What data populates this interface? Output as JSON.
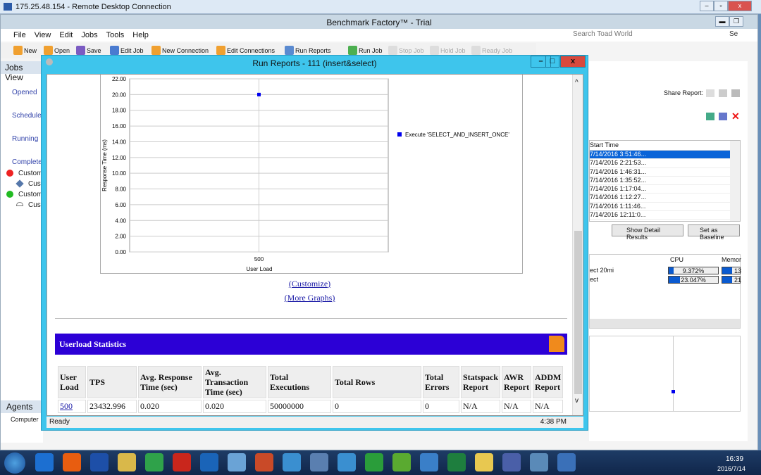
{
  "rdp": {
    "title": "175.25.48.154 - Remote Desktop Connection"
  },
  "app": {
    "title": "Benchmark Factory™ - Trial",
    "menu": [
      "File",
      "View",
      "Edit",
      "Jobs",
      "Tools",
      "Help"
    ],
    "toolbar": [
      {
        "label": "New",
        "enabled": true
      },
      {
        "label": "Open",
        "enabled": true
      },
      {
        "label": "Save",
        "enabled": true
      },
      {
        "label": "Edit Job",
        "enabled": true
      },
      {
        "label": "New Connection",
        "enabled": true
      },
      {
        "label": "Edit Connections",
        "enabled": true
      },
      {
        "label": "Run Reports",
        "enabled": true
      },
      {
        "label": "Run Job",
        "enabled": true
      },
      {
        "label": "Stop Job",
        "enabled": false
      },
      {
        "label": "Hold Job",
        "enabled": false
      },
      {
        "label": "Ready Job",
        "enabled": false
      }
    ],
    "search_placeholder": "Search Toad World",
    "search_btn": "Se"
  },
  "left": {
    "header": "Jobs View",
    "groups": [
      "Opened",
      "Scheduled",
      "Running",
      "Completed"
    ],
    "items": [
      {
        "label": "Custom",
        "icon": "error-icon"
      },
      {
        "label": "Custo",
        "icon": "diamond-icon"
      },
      {
        "label": "Custom",
        "icon": "success-icon"
      },
      {
        "label": "Custo",
        "icon": "gauge-icon"
      }
    ],
    "agents_header": "Agents",
    "agents_col": "Computer"
  },
  "right": {
    "share_label": "Share Report:",
    "list_header": "Start Time",
    "start_times": [
      "7/14/2016 3:51:46...",
      "7/14/2016 2:21:53...",
      "7/14/2016 1:46:31...",
      "7/14/2016 1:35:52...",
      "7/14/2016 1:17:04...",
      "7/14/2016 1:12:27...",
      "7/14/2016 1:11:46...",
      "7/14/2016 12:11:0..."
    ],
    "show_detail": "Show Detail Results",
    "set_baseline": "Set as Baseline",
    "res_cols": [
      "CPU",
      "Memor"
    ],
    "res_rows": [
      {
        "name": "ect 20mi",
        "cpu": "9.372%",
        "cpu_pct": 9.372,
        "mem": "13"
      },
      {
        "name": "ect",
        "cpu": "23.047%",
        "cpu_pct": 23.047,
        "mem": "21"
      }
    ]
  },
  "report": {
    "title": "Run Reports - 111 (insert&select)",
    "customize": "(Customize)",
    "more_graphs": "(More Graphs)",
    "section_title": "Userload Statistics",
    "columns": [
      "User Load",
      "TPS",
      "Avg. Response Time (sec)",
      "Avg. Transaction Time (sec)",
      "Total Executions",
      "Total Rows",
      "Total Errors",
      "Statspack Report",
      "AWR Report",
      "ADDM Report"
    ],
    "rows": [
      [
        "500",
        "23432.996",
        "0.020",
        "0.020",
        "50000000",
        "0",
        "0",
        "N/A",
        "N/A",
        "N/A"
      ]
    ],
    "status": "Ready",
    "status_time": "4:38 PM"
  },
  "chart_data": {
    "type": "line",
    "x": [
      500
    ],
    "categories": [
      "500"
    ],
    "series": [
      {
        "name": "Execute  'SELECT_AND_INSERT_ONCE'",
        "values": [
          20
        ],
        "color": "#0000ee"
      }
    ],
    "xlabel": "User Load",
    "ylabel": "Response Time (ms)",
    "ylim": [
      0,
      22
    ],
    "yticks": [
      "0.00",
      "2.00",
      "4.00",
      "6.00",
      "8.00",
      "10.00",
      "12.00",
      "14.00",
      "16.00",
      "18.00",
      "20.00",
      "22.00"
    ],
    "grid": true,
    "legend": "right"
  },
  "taskbar": {
    "time": "16:39",
    "date": "2016/7/14"
  }
}
